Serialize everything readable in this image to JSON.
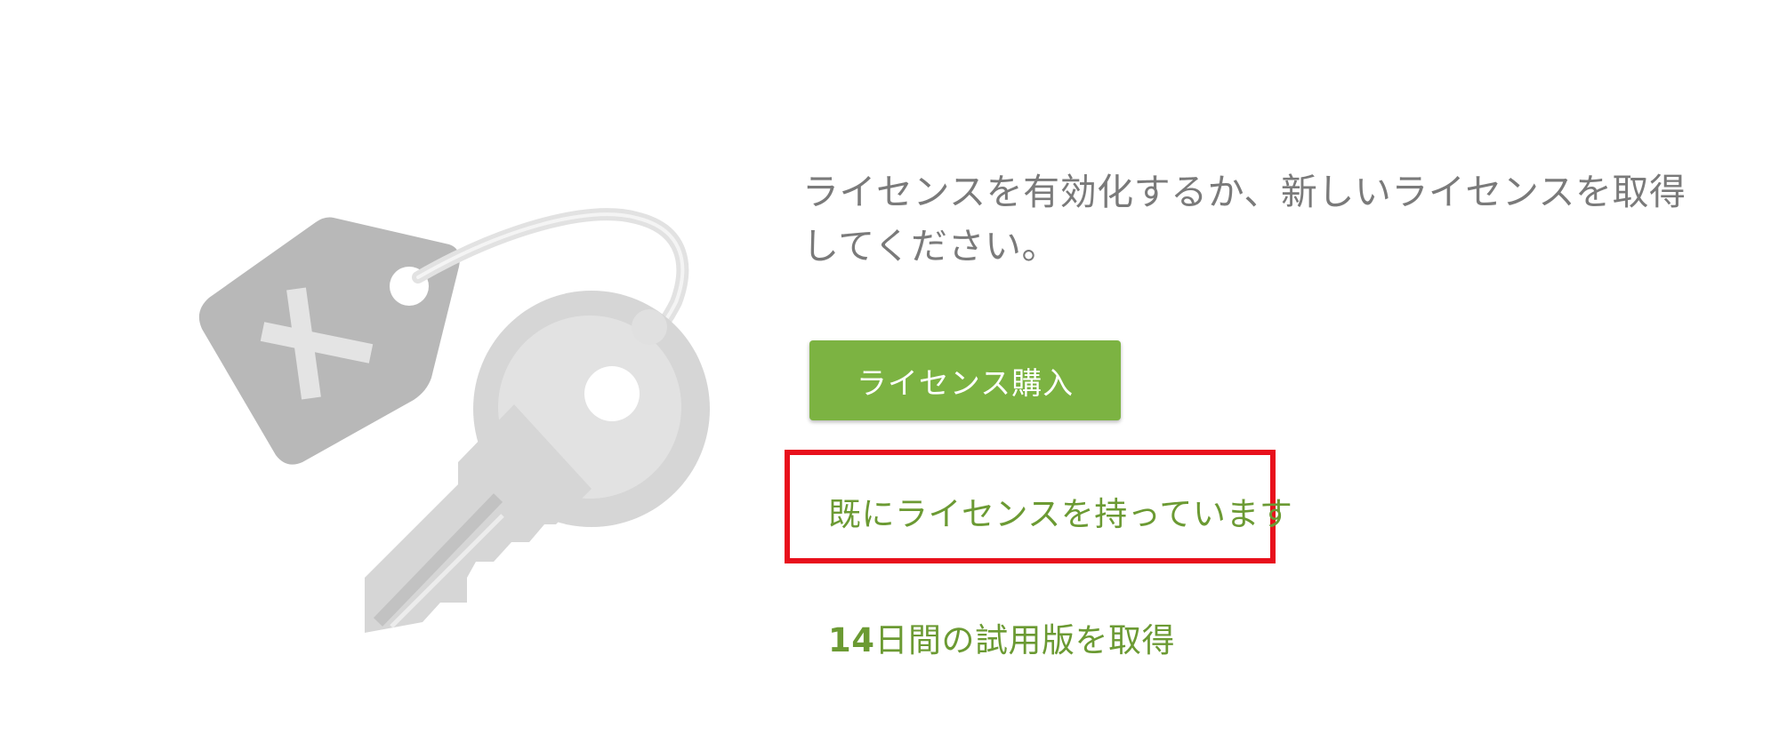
{
  "prompt": {
    "message": "ライセンスを有効化するか、新しいライセンスを取得してください。"
  },
  "actions": {
    "buy_license_label": "ライセンス購入",
    "have_license_label": "既にライセンスを持っています",
    "trial_number": "14",
    "trial_label": "日間の試用版を取得"
  },
  "illustration": {
    "icon": "license-key-tag-icon"
  },
  "colors": {
    "accent_green": "#7cb342",
    "link_green": "#6b9a33",
    "highlight_red": "#e8101c",
    "prompt_gray": "#7a7a7a",
    "tag_gray": "#b8b8b8",
    "key_gray": "#d6d6d6"
  }
}
